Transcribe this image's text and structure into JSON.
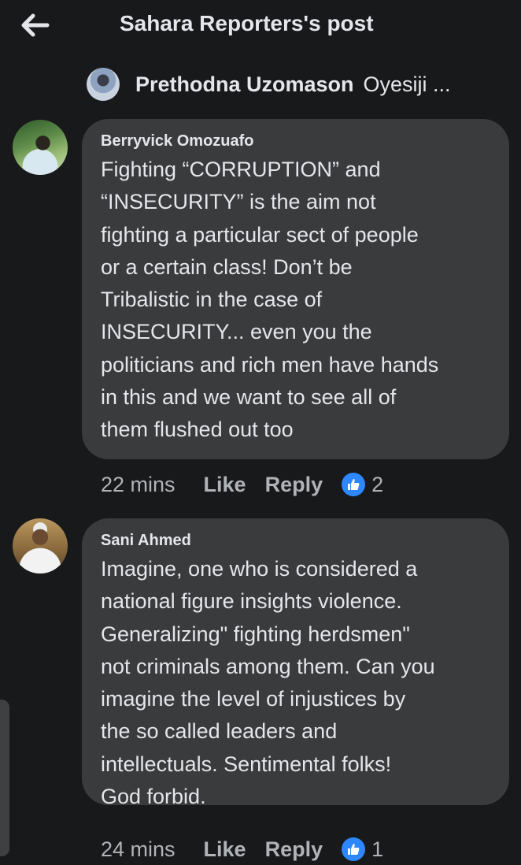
{
  "header": {
    "title": "Sahara Reporters's post",
    "back_icon": "arrow-left-icon"
  },
  "reply_context": {
    "name": "Prethodna Uzomason",
    "extra": "Oyesiji ..."
  },
  "comments": [
    {
      "author": "Berryvick Omozuafo",
      "text": "Fighting “CORRUPTION” and\n“INSECURITY” is the aim not\nfighting a particular sect of people\nor a certain class! Don’t be\nTribalistic in the case of\nINSECURITY... even you the\npoliticians and rich men have hands\nin this and we want to see all of\nthem flushed out too",
      "time": "22 mins",
      "like_label": "Like",
      "reply_label": "Reply",
      "reactions": "2"
    },
    {
      "author": "Sani Ahmed",
      "text": "Imagine, one who is considered a\nnational figure insights violence.\nGeneralizing\" fighting herdsmen\"\nnot criminals among them. Can you\nimagine the level of injustices by\nthe so called leaders and\nintellectuals. Sentimental folks!\nGod forbid.",
      "time": "24 mins",
      "like_label": "Like",
      "reply_label": "Reply",
      "reactions": "1"
    }
  ],
  "colors": {
    "background": "#18191a",
    "bubble": "#3a3b3c",
    "text_primary": "#e4e6eb",
    "text_secondary": "#b0b3b8",
    "like_blue": "#2d88ff"
  }
}
